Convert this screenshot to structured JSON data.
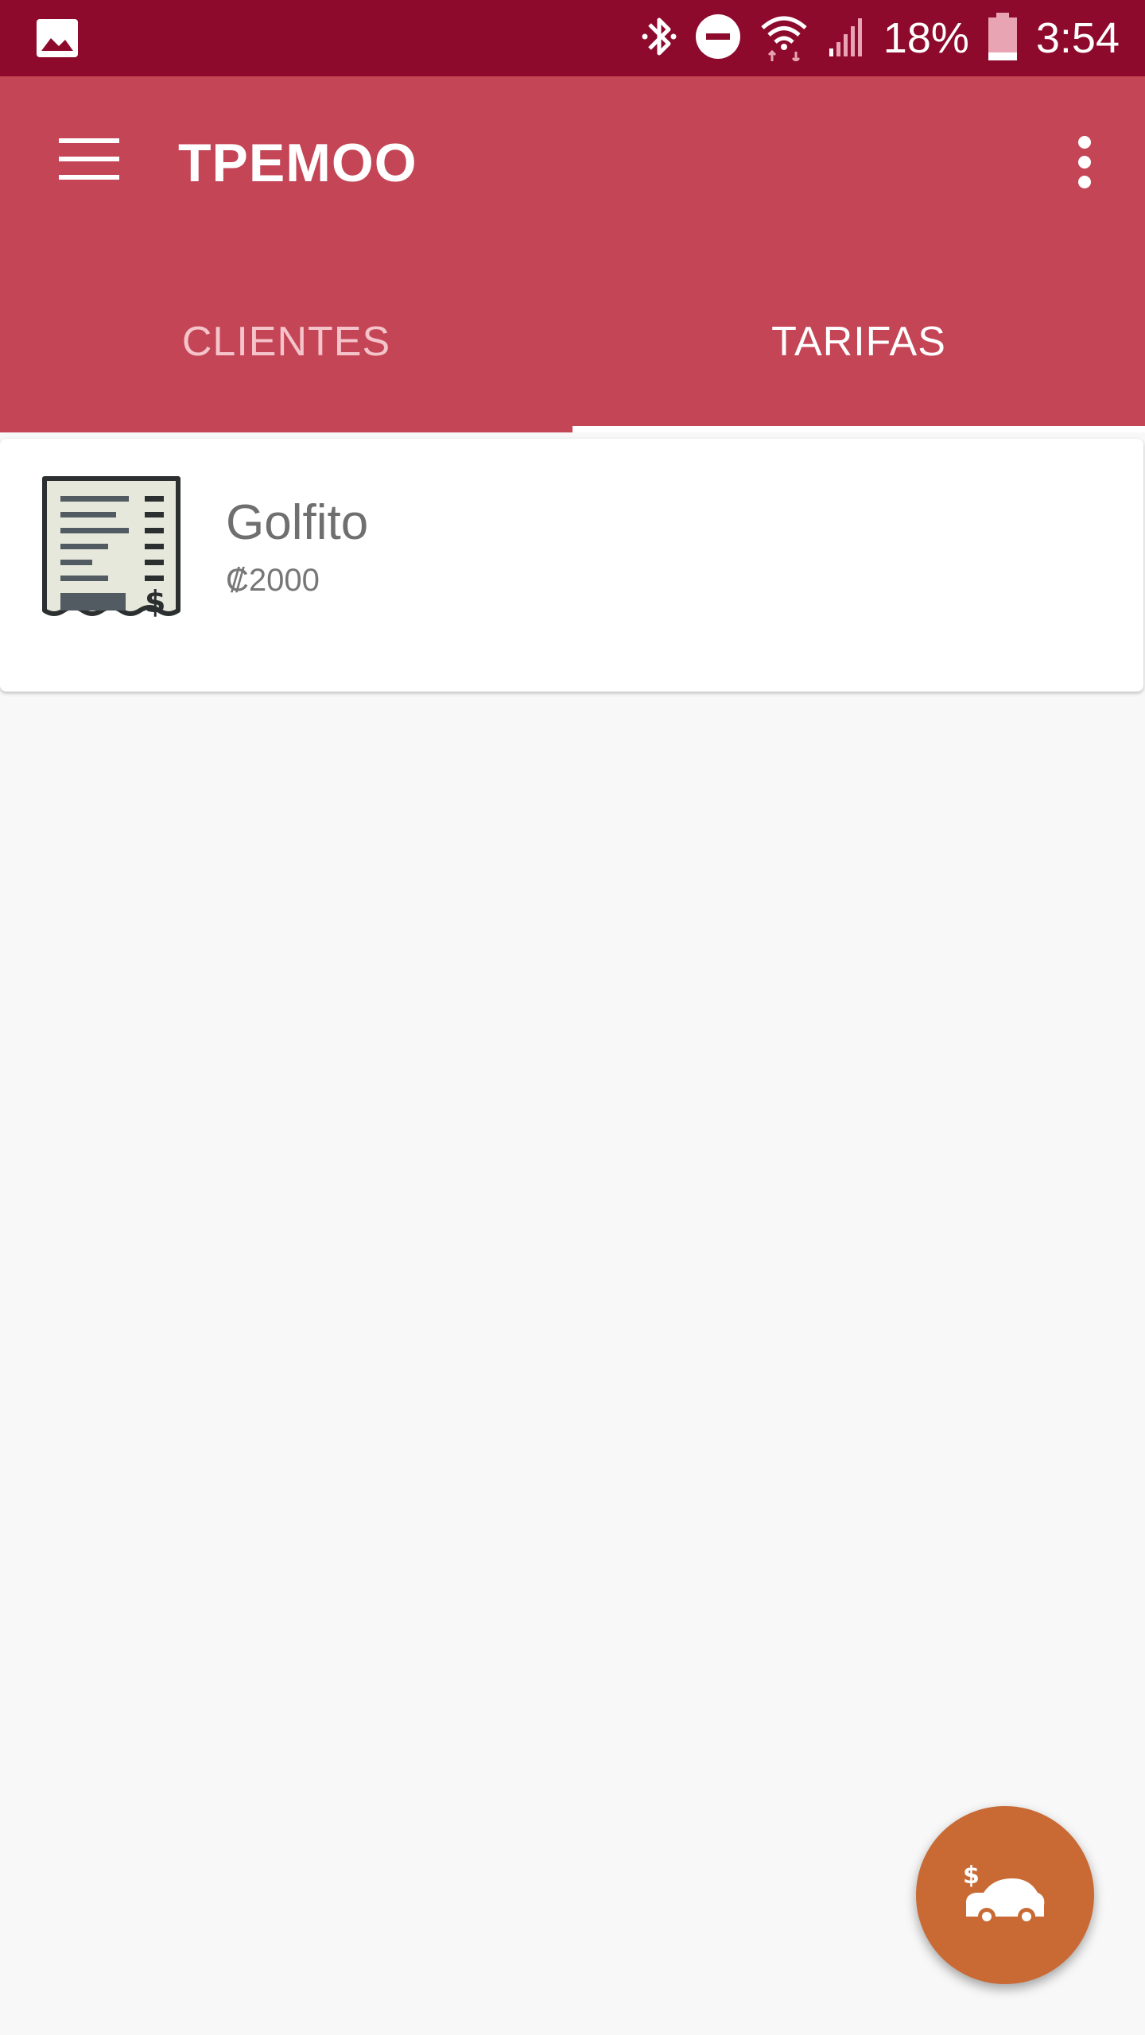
{
  "status_bar": {
    "battery": "18%",
    "time": "3:54",
    "icons": [
      "gallery-icon",
      "bluetooth-icon",
      "do-not-disturb-icon",
      "wifi-icon",
      "signal-icon",
      "battery-icon"
    ]
  },
  "app_bar": {
    "title": "TPEMOO",
    "tabs": [
      {
        "label": "CLIENTES",
        "active": false
      },
      {
        "label": "TARIFAS",
        "active": true
      }
    ]
  },
  "list": {
    "items": [
      {
        "title": "Golfito",
        "subtitle": "₡2000",
        "icon": "receipt-icon"
      }
    ]
  },
  "fab": {
    "icon": "car-dollar-icon"
  },
  "colors": {
    "status_bar": "#8e0a2c",
    "app_bar": "#c44556",
    "fab": "#c96a35",
    "background": "#f8f8f8"
  }
}
